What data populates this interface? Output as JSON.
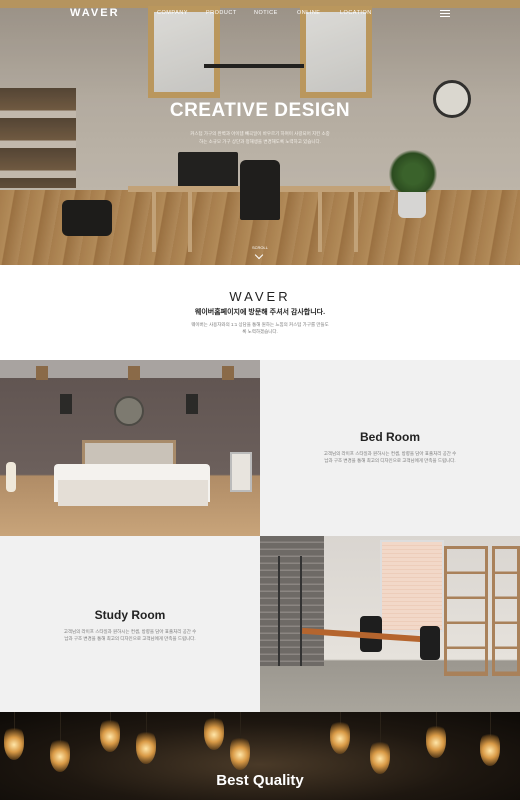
{
  "brand": {
    "logo": "WAVER"
  },
  "nav": {
    "items": [
      "COMPANY",
      "PRODUCT",
      "NOTICE",
      "ONLINE",
      "LOCATION"
    ]
  },
  "hero": {
    "title": "CREATIVE DESIGN",
    "subtitle": "커스텀 가구의 완벽과 아이템 빼곡일이 바우르기 하며이 사랑되어 지킨 소중하는 소규모 가구 상단과 정해생을 변경해도록 노력하고 있습니다.",
    "scroll": "SCROLL"
  },
  "intro": {
    "logo": "WAVER",
    "title": "웨이버홈페이지에 방문해 주셔서 감사합니다.",
    "description": "웨이버는 사용자와의 1:1 상담을 통해 원하는 느낌의 커스텀 가구를 만들도록 노력하겠습니다."
  },
  "sections": {
    "bedroom": {
      "title": "Bed Room",
      "description": "고객님의 라이프 스타일과 원하시는 컨셉, 방향을 담아 표출처리 공간 수납과 구조 변경을 통해 최고의 디자인으로 고객님에게 만족을 드립니다."
    },
    "study": {
      "title": "Study Room",
      "description": "고객님의 라이프 스타일과 원하시는 컨셉, 방향을 담아 표출처리 공간 수납과 구조 변경을 통해 최고의 디자인으로 고객님에게 만족을 드립니다."
    }
  },
  "quality": {
    "title": "Best Quality"
  }
}
